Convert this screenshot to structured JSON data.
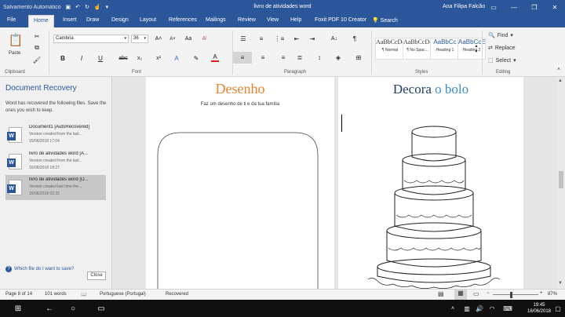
{
  "title_bar": {
    "autosave": "Salvamento Automático",
    "doc_title": "livro de atividades word",
    "user": "Ana Filipa Falcão"
  },
  "tabs": [
    "File",
    "Home",
    "Insert",
    "Draw",
    "Design",
    "Layout",
    "References",
    "Mailings",
    "Review",
    "View",
    "Help",
    "Foxit PDF 10 Creator",
    "Search"
  ],
  "ribbon": {
    "clipboard": {
      "paste": "Paste",
      "label": "Clipboard"
    },
    "font": {
      "name": "Cambria",
      "size": "36",
      "label": "Font"
    },
    "paragraph": {
      "label": "Paragraph"
    },
    "styles": {
      "items": [
        {
          "sample": "AaBbCcDc",
          "name": "¶ Normal"
        },
        {
          "sample": "AaBbCcDc",
          "name": "¶ No Spac..."
        },
        {
          "sample": "AaBbCc",
          "name": "Heading 1"
        },
        {
          "sample": "AaBbCcE",
          "name": "Heading 2"
        }
      ],
      "label": "Styles"
    },
    "editing": {
      "find": "Find",
      "replace": "Replace",
      "select": "Select",
      "label": "Editing"
    }
  },
  "recovery": {
    "title": "Document Recovery",
    "description": "Word has recovered the following files. Save the ones you wish to keep.",
    "files": [
      {
        "name": "Document1 [AutoRecovered]",
        "line1": "Version created from the last...",
        "date": "15/06/2018 17:04"
      },
      {
        "name": "livro de atividades word [A...",
        "line1": "Version created from the last...",
        "date": "16/06/2018 18:27"
      },
      {
        "name": "livro de atividades word [O...",
        "line1": "Version created last time the...",
        "date": "16/06/2018 02:32"
      }
    ],
    "help_link": "Which file do I want to save?",
    "close": "Close"
  },
  "page_left": {
    "heading": "Desenho",
    "instruction": "Faz um desenho de ti e da tua família"
  },
  "page_right": {
    "heading_part1": "Decora",
    "heading_part2": "o bolo"
  },
  "status": {
    "page": "Page 8 of 14",
    "words": "101 words",
    "language": "Portuguese (Portugal)",
    "state": "Recovered",
    "zoom": "87%"
  },
  "taskbar": {
    "time": "19:45",
    "date": "16/06/2018"
  },
  "colors": {
    "accent": "#2b579a",
    "desenho": "#e8832e",
    "decora": "#1e3f66",
    "obolo": "#3a8fd0",
    "font_color_bar": "#e01c1c"
  }
}
